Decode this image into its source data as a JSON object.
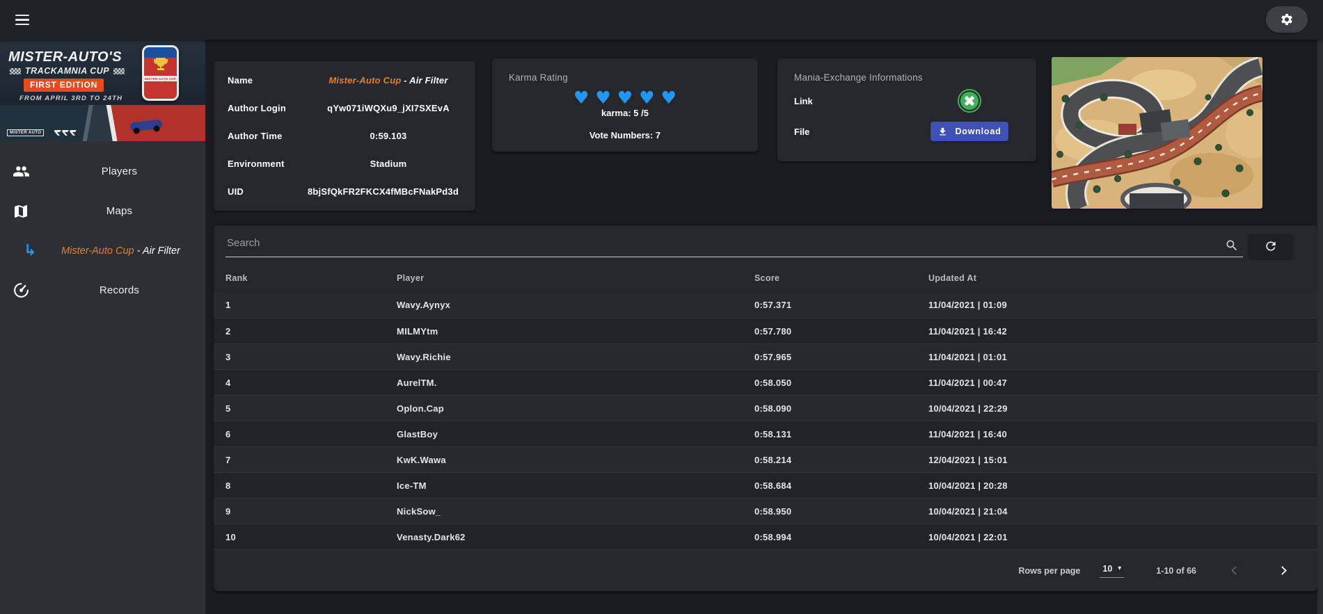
{
  "colors": {
    "accent_orange": "#e08130",
    "heart_blue": "#2196f3",
    "download_indigo": "#3f51b5",
    "mx_green": "#43b05c",
    "sub_arrow_blue": "#2196f3"
  },
  "sidebar": {
    "banner": {
      "title": "MISTER-AUTO'S",
      "subtitle": "TRACKAMNIA CUP",
      "edition": "FIRST EDITION",
      "dates": "FROM APRIL 3RD TO 24TH",
      "badge_text": "MISTER-AUTO CUP",
      "brand_small": "MISTER AUTO"
    },
    "items": [
      {
        "label": "Players",
        "icon": "people-icon"
      },
      {
        "label": "Maps",
        "icon": "map-icon"
      },
      {
        "accent": "Mister-Auto Cup",
        "rest": " - Air Filter",
        "icon": "subdirectory-arrow-icon"
      },
      {
        "label": "Records",
        "icon": "speedometer-icon"
      }
    ]
  },
  "cards": {
    "map_info": {
      "name_label": "Name",
      "name_accent": "Mister-Auto Cup",
      "name_rest": " - Air Filter",
      "author_login_label": "Author Login",
      "author_login": "qYw071iWQXu9_jXI7SXEvA",
      "author_time_label": "Author Time",
      "author_time": "0:59.103",
      "environment_label": "Environment",
      "environment": "Stadium",
      "uid_label": "UID",
      "uid": "8bjSfQkFR2FKCX4fMBcFNakPd3d"
    },
    "karma": {
      "title": "Karma Rating",
      "hearts": [
        "♥",
        "♥",
        "♥",
        "♥",
        "♥"
      ],
      "karma_line": "karma: 5 /5",
      "votes_line": "Vote Numbers: 7"
    },
    "mania_exchange": {
      "title": "Mania-Exchange Informations",
      "link_label": "Link",
      "file_label": "File",
      "download_label": "Download"
    }
  },
  "records_table": {
    "search_placeholder": "Search",
    "columns": [
      "Rank",
      "Player",
      "Score",
      "Updated At"
    ],
    "rows": [
      {
        "rank": "1",
        "player": "Wavy.Aynyx",
        "score": "0:57.371",
        "updated": "11/04/2021 | 01:09"
      },
      {
        "rank": "2",
        "player": "MILMYtm",
        "score": "0:57.780",
        "updated": "11/04/2021 | 16:42"
      },
      {
        "rank": "3",
        "player": "Wavy.Richie",
        "score": "0:57.965",
        "updated": "11/04/2021 | 01:01"
      },
      {
        "rank": "4",
        "player": "AurelTM.",
        "score": "0:58.050",
        "updated": "11/04/2021 | 00:47"
      },
      {
        "rank": "5",
        "player": "Oplon.Cap",
        "score": "0:58.090",
        "updated": "10/04/2021 | 22:29"
      },
      {
        "rank": "6",
        "player": "GlastBoy",
        "score": "0:58.131",
        "updated": "11/04/2021 | 16:40"
      },
      {
        "rank": "7",
        "player": "KwK.Wawa",
        "score": "0:58.214",
        "updated": "12/04/2021 | 15:01"
      },
      {
        "rank": "8",
        "player": "Ice-TM",
        "score": "0:58.684",
        "updated": "10/04/2021 | 20:28"
      },
      {
        "rank": "9",
        "player": "NickSow_",
        "score": "0:58.950",
        "updated": "10/04/2021 | 21:04"
      },
      {
        "rank": "10",
        "player": "Venasty.Dark62",
        "score": "0:58.994",
        "updated": "10/04/2021 | 22:01"
      }
    ],
    "pagination": {
      "rows_per_page_label": "Rows per page",
      "rows_per_page": "10",
      "range": "1-10 of 66"
    }
  }
}
